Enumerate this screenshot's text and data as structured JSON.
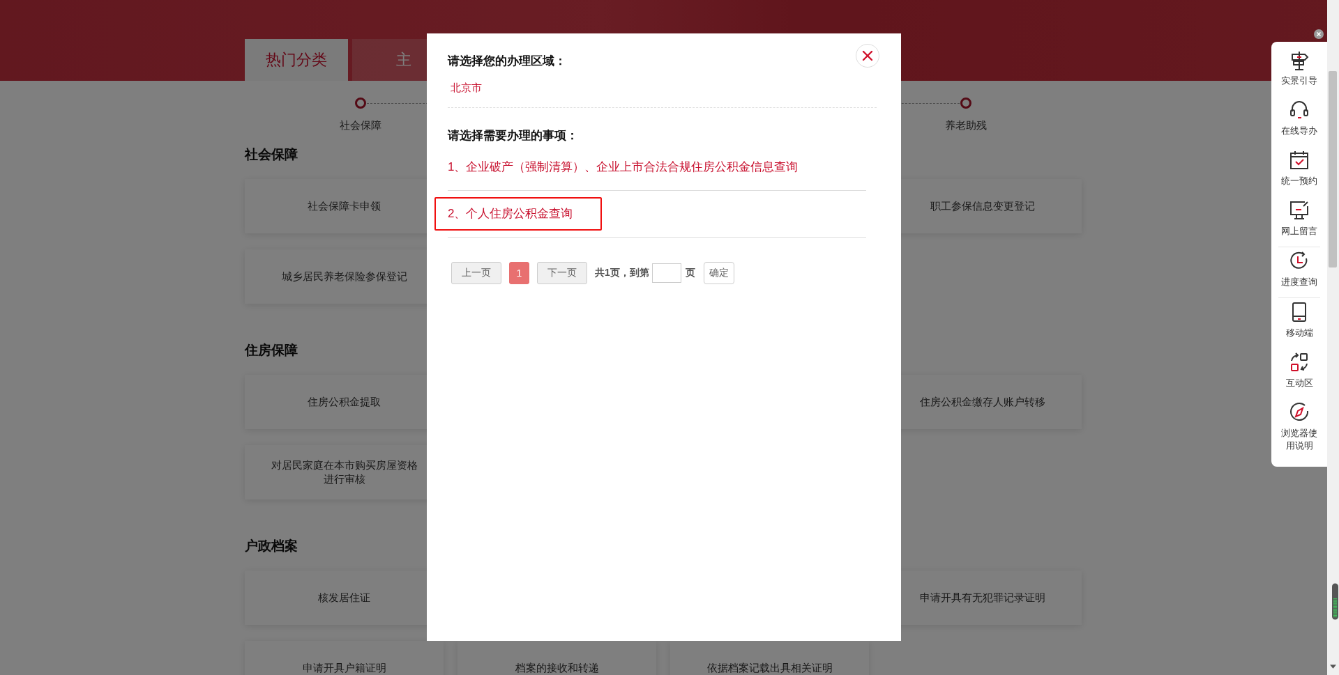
{
  "tabs": [
    {
      "label": "热门分类",
      "selected": true
    },
    {
      "label": "主",
      "selected": false
    }
  ],
  "steps": [
    {
      "label": "社会保障"
    },
    {
      "label": "养老助残"
    }
  ],
  "sections": [
    {
      "title": "社会保障",
      "cards": [
        {
          "kind": "card",
          "label": "社会保障卡申领"
        },
        {
          "kind": "covered"
        },
        {
          "kind": "covered"
        },
        {
          "kind": "card",
          "label": "职工参保信息变更登记"
        },
        {
          "kind": "card",
          "label": "城乡居民养老保险参保登记"
        }
      ]
    },
    {
      "title": "住房保障",
      "cards": [
        {
          "kind": "card",
          "label": "住房公积金提取"
        },
        {
          "kind": "covered"
        },
        {
          "kind": "covered"
        },
        {
          "kind": "card",
          "label": "住房公积金缴存人账户转移"
        },
        {
          "kind": "card",
          "label": "对居民家庭在本市购买房屋资格进行审核"
        }
      ]
    },
    {
      "title": "户政档案",
      "cards": [
        {
          "kind": "card",
          "label": "核发居住证"
        },
        {
          "kind": "covered"
        },
        {
          "kind": "covered"
        },
        {
          "kind": "card",
          "label": "申请开具有无犯罪记录证明"
        },
        {
          "kind": "card",
          "label": "申请开具户籍证明"
        },
        {
          "kind": "card",
          "label": "档案的接收和转递"
        },
        {
          "kind": "card",
          "label": "依据档案记载出具相关证明"
        }
      ]
    }
  ],
  "modal": {
    "region_title": "请选择您的办理区域：",
    "region": "北京市",
    "items_title": "请选择需要办理的事项：",
    "items": [
      {
        "label": "1、企业破产（强制清算）、企业上市合法合规住房公积金信息查询",
        "highlighted": false
      },
      {
        "label": "2、个人住房公积金查询",
        "highlighted": true
      }
    ],
    "pagination": {
      "prev": "上一页",
      "pages": [
        {
          "label": "1",
          "selected": true
        }
      ],
      "next": "下一页",
      "total": "共1页，到第",
      "unit": "页",
      "confirm": "确定"
    }
  },
  "sidebar": {
    "items": [
      {
        "label": "实景引导",
        "divider": false
      },
      {
        "label": "在线导办",
        "divider": false
      },
      {
        "label": "统一预约",
        "divider": false
      },
      {
        "label": "网上留言",
        "divider": true
      },
      {
        "label": "进度查询",
        "divider": true
      },
      {
        "label": "移动端",
        "divider": false
      },
      {
        "label": "互动区",
        "divider": false
      },
      {
        "label": "浏览器使用说明",
        "divider": false
      }
    ]
  }
}
